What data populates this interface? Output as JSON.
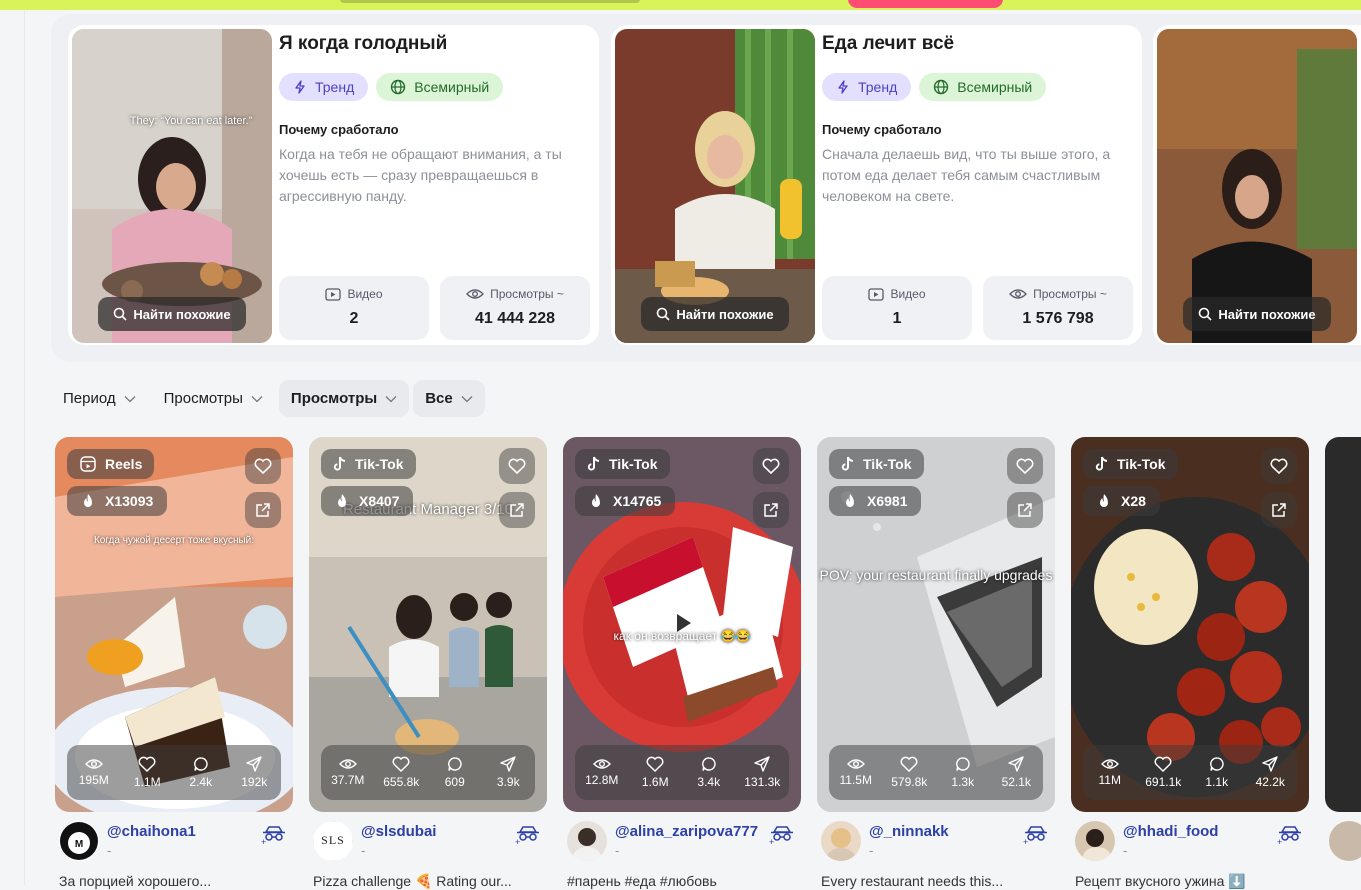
{
  "trends": [
    {
      "title": "Я когда голодный",
      "badges": [
        "Тренд",
        "Всемирный"
      ],
      "why_label": "Почему сработало",
      "description": "Когда на тебя не обращают внимания, а ты хочешь есть — сразу превращаешься в агрессивную панду.",
      "overlay_text": "They: “You can eat later.”",
      "find_label": "Найти похожие",
      "video_label": "Видео",
      "video_count": "2",
      "views_label": "Просмотры ~",
      "views_count": "41 444 228"
    },
    {
      "title": "Еда лечит всё",
      "badges": [
        "Тренд",
        "Всемирный"
      ],
      "why_label": "Почему сработало",
      "description": "Сначала делаешь вид, что ты выше этого, а потом еда делает тебя самым счастливым человеком на свете.",
      "overlay_text": "",
      "find_label": "Найти похожие",
      "video_label": "Видео",
      "video_count": "1",
      "views_label": "Просмотры ~",
      "views_count": "1 576 798"
    },
    {
      "find_label": "Найти похожие"
    }
  ],
  "filters": [
    {
      "label": "Период",
      "active": false
    },
    {
      "label": "Просмотры",
      "active": false
    },
    {
      "label": "Просмотры",
      "active": true
    },
    {
      "label": "Все",
      "active": false
    }
  ],
  "videos": [
    {
      "platform": "Reels",
      "multiplier": "X13093",
      "overlay": "Когда чужой десерт тоже вкусный:",
      "views": "195M",
      "likes": "1.1M",
      "comments": "2.4k",
      "shares": "192k",
      "handle": "@chaihona1",
      "subtitle": "-",
      "caption": "За порцией хорошего..."
    },
    {
      "platform": "Tik-Tok",
      "multiplier": "X8407",
      "overlay": "Restaurant Manager 3/10",
      "views": "37.7M",
      "likes": "655.8k",
      "comments": "609",
      "shares": "3.9k",
      "handle": "@slsdubai",
      "subtitle": "-",
      "caption": "Pizza challenge 🍕 Rating our..."
    },
    {
      "platform": "Tik-Tok",
      "multiplier": "X14765",
      "overlay": "как он возвращает 😂😂",
      "views": "12.8M",
      "likes": "1.6M",
      "comments": "3.4k",
      "shares": "131.3k",
      "handle": "@alina_zaripova777",
      "subtitle": "-",
      "caption": "#парень #еда #любовь"
    },
    {
      "platform": "Tik-Tok",
      "multiplier": "X6981",
      "overlay": "POV: your restaurant finally upgrades",
      "views": "11.5M",
      "likes": "579.8k",
      "comments": "1.3k",
      "shares": "52.1k",
      "handle": "@_ninnakk",
      "subtitle": "-",
      "caption": "Every restaurant needs this..."
    },
    {
      "platform": "Tik-Tok",
      "multiplier": "X28",
      "overlay": "",
      "views": "11M",
      "likes": "691.1k",
      "comments": "1.1k",
      "shares": "42.2k",
      "handle": "@hhadi_food",
      "subtitle": "-",
      "caption": "Рецепт вкусного ужина ⬇️"
    }
  ],
  "avatar_text": {
    "slsdubai": "SLS"
  },
  "colors": {
    "accent_lime": "#d9f45b",
    "accent_pink": "#ff4d73",
    "handle_blue": "#2d3fa8",
    "badge_trend_bg": "#e3e0ff",
    "badge_world_bg": "#dcf5d6"
  }
}
